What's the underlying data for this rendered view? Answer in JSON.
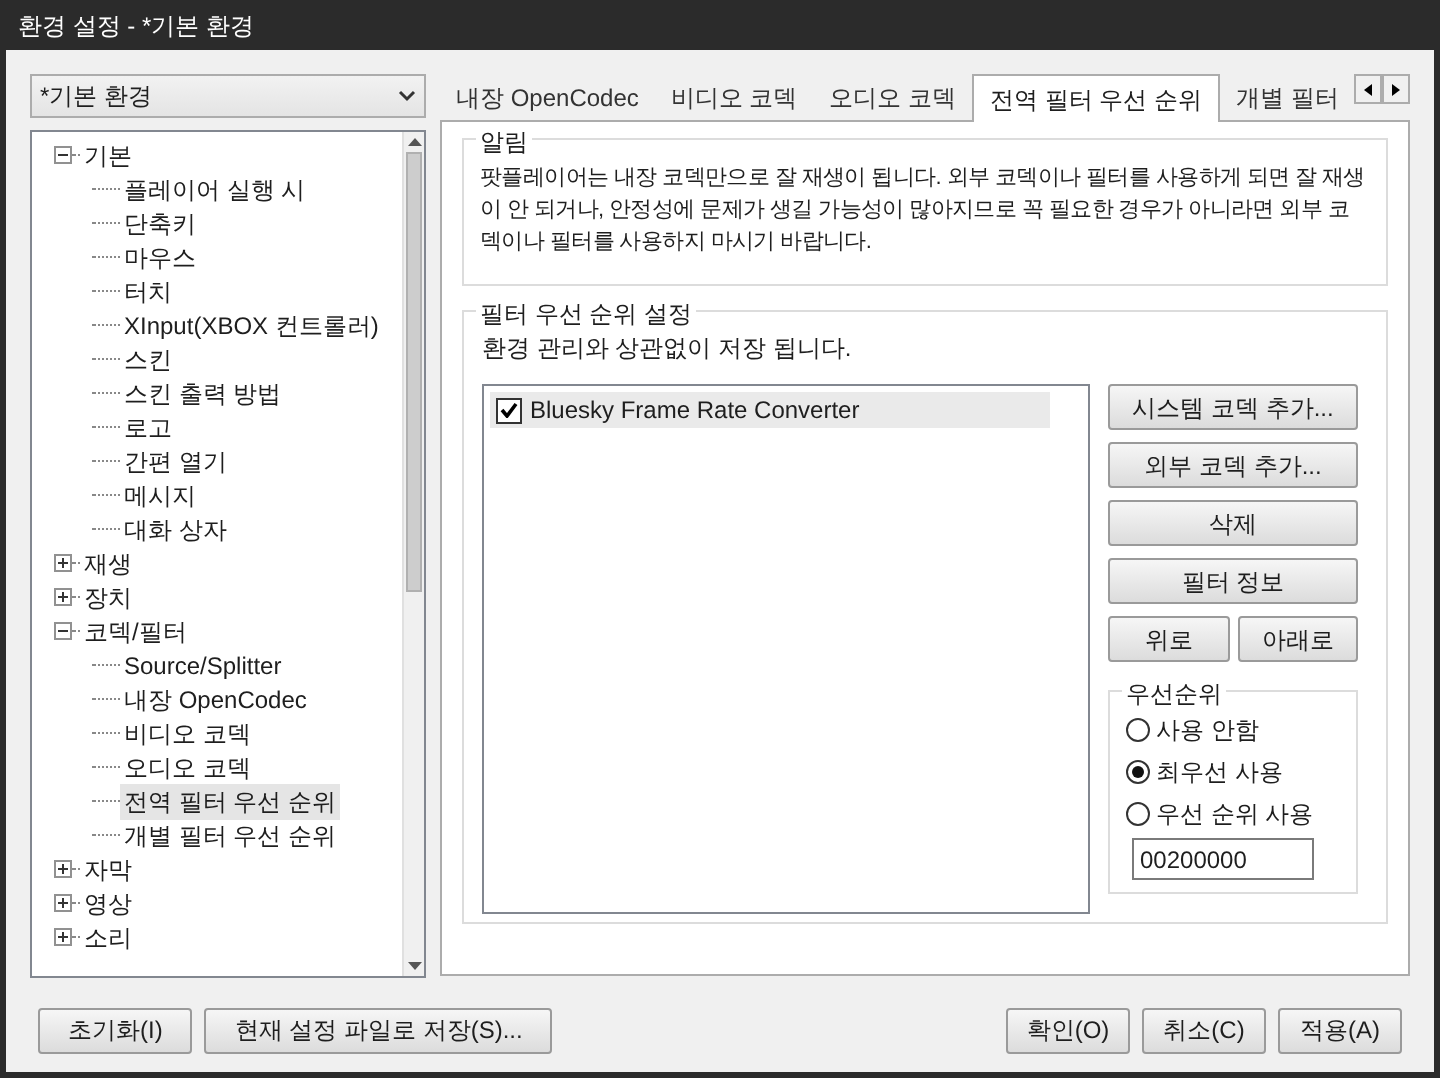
{
  "window": {
    "title": "환경 설정 - *기본 환경"
  },
  "profile_select": {
    "value": "*기본 환경"
  },
  "tree": [
    {
      "label": "기본",
      "expanded": true,
      "selected": false,
      "children": [
        {
          "label": "플레이어 실행 시",
          "selected": false
        },
        {
          "label": "단축키",
          "selected": false
        },
        {
          "label": "마우스",
          "selected": false
        },
        {
          "label": "터치",
          "selected": false
        },
        {
          "label": "XInput(XBOX 컨트롤러)",
          "selected": false
        },
        {
          "label": "스킨",
          "selected": false
        },
        {
          "label": "스킨 출력 방법",
          "selected": false
        },
        {
          "label": "로고",
          "selected": false
        },
        {
          "label": "간편 열기",
          "selected": false
        },
        {
          "label": "메시지",
          "selected": false
        },
        {
          "label": "대화 상자",
          "selected": false
        }
      ]
    },
    {
      "label": "재생",
      "expanded": false,
      "selected": false
    },
    {
      "label": "장치",
      "expanded": false,
      "selected": false
    },
    {
      "label": "코덱/필터",
      "expanded": true,
      "selected": false,
      "children": [
        {
          "label": "Source/Splitter",
          "selected": false
        },
        {
          "label": "내장 OpenCodec",
          "selected": false
        },
        {
          "label": "비디오 코덱",
          "selected": false
        },
        {
          "label": "오디오 코덱",
          "selected": false
        },
        {
          "label": "전역 필터 우선 순위",
          "selected": true
        },
        {
          "label": "개별 필터 우선 순위",
          "selected": false
        }
      ]
    },
    {
      "label": "자막",
      "expanded": false,
      "selected": false
    },
    {
      "label": "영상",
      "expanded": false,
      "selected": false
    },
    {
      "label": "소리",
      "expanded": false,
      "selected": false
    }
  ],
  "tabs": [
    {
      "label": "내장 OpenCodec",
      "selected": false
    },
    {
      "label": "비디오 코덱",
      "selected": false
    },
    {
      "label": "오디오 코덱",
      "selected": false
    },
    {
      "label": "전역 필터 우선 순위",
      "selected": true
    },
    {
      "label": "개별 필터",
      "selected": false
    }
  ],
  "notice": {
    "title": "알림",
    "text": "팟플레이어는 내장 코덱만으로 잘 재생이 됩니다. 외부 코덱이나 필터를 사용하게 되면 잘 재생이 안 되거나, 안정성에 문제가 생길 가능성이 많아지므로 꼭 필요한 경우가 아니라면 외부 코덱이나 필터를 사용하지 마시기 바랍니다."
  },
  "filter_priority": {
    "title": "필터 우선 순위 설정",
    "subtitle": "환경 관리와 상관없이 저장 됩니다.",
    "filters": [
      {
        "label": "Bluesky Frame Rate Converter",
        "checked": true,
        "selected": true
      }
    ],
    "buttons": [
      "시스템 코덱 추가...",
      "외부 코덱 추가...",
      "삭제",
      "필터 정보"
    ],
    "move_buttons": [
      "위로",
      "아래로"
    ],
    "priority": {
      "title": "우선순위",
      "options": [
        {
          "label": "사용 안함",
          "selected": false
        },
        {
          "label": "최우선 사용",
          "selected": true
        },
        {
          "label": "우선 순위 사용",
          "selected": false
        }
      ],
      "value": "00200000"
    }
  },
  "footer": {
    "left_buttons": [
      "초기화(I)",
      "현재 설정 파일로 저장(S)..."
    ],
    "right_buttons": [
      "확인(O)",
      "취소(C)",
      "적용(A)"
    ]
  }
}
